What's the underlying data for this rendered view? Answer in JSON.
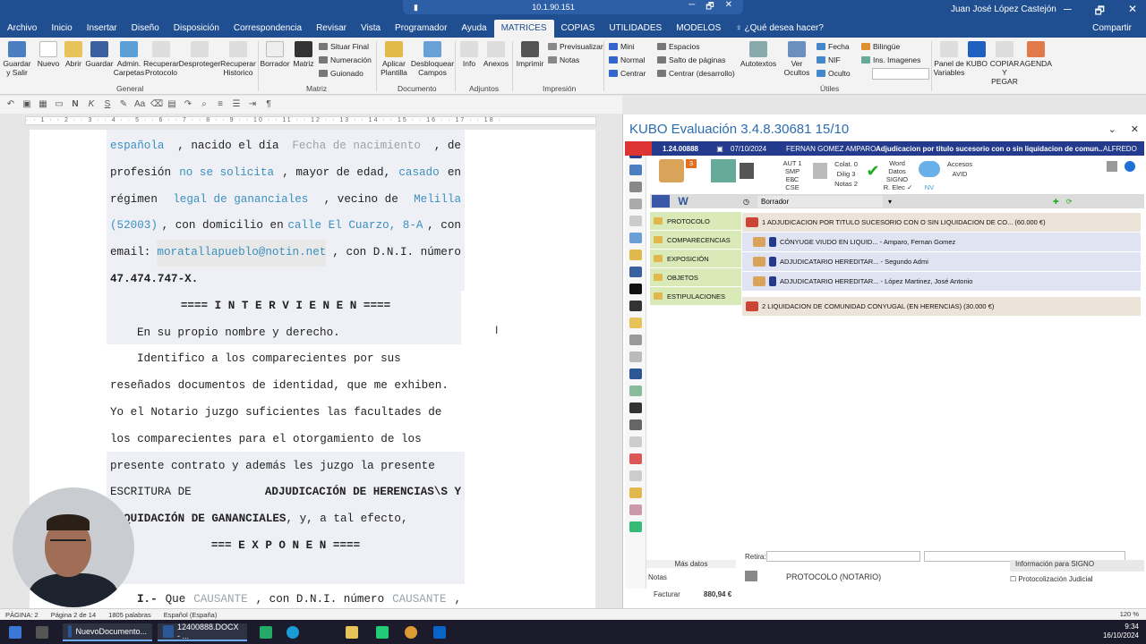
{
  "remote_bar": {
    "ip": "10.1.90.151",
    "controls": [
      "─",
      "🗗",
      "✕"
    ]
  },
  "window": {
    "user": "Juan José López Castejón",
    "controls": [
      "─",
      "🗗",
      "✕"
    ]
  },
  "ribbon_tabs": [
    "Archivo",
    "Inicio",
    "Insertar",
    "Diseño",
    "Disposición",
    "Correspondencia",
    "Revisar",
    "Vista",
    "Programador",
    "Ayuda",
    "MATRICES",
    "COPIAS",
    "UTILIDADES",
    "MODELOS",
    "♀ ¿Qué desea hacer?"
  ],
  "share": "Compartir",
  "ribbon": {
    "general": [
      "Guardar y Salir",
      "Nuevo",
      "Abrir",
      "Guardar",
      "Admin. Carpetas",
      "Recuperar Protocolo",
      "Desproteger",
      "Recuperar Historico"
    ],
    "general_label": "General",
    "matriz": [
      "Borrador",
      "Matriz"
    ],
    "matriz_small": [
      "Situar Final",
      "Numeración",
      "Guionado"
    ],
    "matriz_label": "Matriz",
    "documento": [
      "Aplicar Plantilla",
      "Desbloquear Campos"
    ],
    "documento_label": "Documento",
    "adjuntos": [
      "Info",
      "Anexos"
    ],
    "adjuntos_label": "Adjuntos",
    "impresion": [
      "Imprimir"
    ],
    "impresion_small": [
      "Previsualizar",
      "Notas"
    ],
    "impresion_label": "Impresión",
    "utiles_small": [
      "Mini",
      "Normal",
      "Centrar",
      "Espacios",
      "Salto de páginas",
      "Centrar (desarrollo)"
    ],
    "utiles": [
      "Autotextos",
      "Ver Ocultos"
    ],
    "utiles_small2": [
      "Fecha",
      "NIF",
      "Oculto"
    ],
    "utiles_label": "Útiles",
    "extra_small": [
      "Bilingüe",
      "Ins. Imagenes"
    ],
    "extra": [
      "Panel de Variables",
      "KUBO",
      "COPIAR Y PEGAR",
      "AGENDA"
    ]
  },
  "document": {
    "lines": [
      {
        "parts": [
          {
            "t": "española",
            "c": "fld"
          },
          {
            "t": ", nacido el día ",
            "c": ""
          },
          {
            "t": "Fecha de nacimiento",
            "c": "fld2"
          },
          {
            "t": ", de",
            "c": ""
          }
        ]
      },
      {
        "parts": [
          {
            "t": "profesión ",
            "c": ""
          },
          {
            "t": "no se solicita",
            "c": "fld"
          },
          {
            "t": ", mayor de edad, ",
            "c": ""
          },
          {
            "t": "casado",
            "c": "fld"
          },
          {
            "t": " en",
            "c": ""
          }
        ]
      },
      {
        "parts": [
          {
            "t": "régimen ",
            "c": ""
          },
          {
            "t": "legal de gananciales",
            "c": "fld"
          },
          {
            "t": ", vecino de ",
            "c": ""
          },
          {
            "t": "Melilla",
            "c": "fld"
          }
        ]
      },
      {
        "parts": [
          {
            "t": "(52003)",
            "c": "fld"
          },
          {
            "t": ", con domicilio en ",
            "c": ""
          },
          {
            "t": "calle El Cuarzo, 8-A",
            "c": "fld"
          },
          {
            "t": ", con",
            "c": ""
          }
        ]
      },
      {
        "parts": [
          {
            "t": "email: ",
            "c": ""
          },
          {
            "t": "moratallapueblo@notin.net",
            "c": "emailfld"
          },
          {
            "t": ", con D.N.I. número",
            "c": ""
          }
        ]
      },
      {
        "parts": [
          {
            "t": "47.474.747-X.",
            "c": "b"
          }
        ]
      }
    ],
    "heading1": "==== I N T E R V I E N E N ====",
    "para1": "En su propio nombre y derecho.",
    "para2_lines": [
      "Identifico a los comparecientes por sus",
      "reseñados documentos de identidad, que me exhiben.",
      "Yo el Notario juzgo suficientes las facultades de",
      "los comparecientes para el otorgamiento de los",
      "presente contrato y además les juzgo la presente"
    ],
    "para2_last": [
      {
        "t": "ESCRITURA DE ",
        "c": ""
      },
      {
        "t": "ADJUDICACIÓN DE HERENCIAS\\S Y",
        "c": "b"
      }
    ],
    "para2_end": [
      {
        "t": "LIQUIDACIÓN DE GANANCIALES",
        "c": "b"
      },
      {
        "t": ", y, a tal efecto,",
        "c": ""
      }
    ],
    "heading2": "=== E X P O N E N ====",
    "para3": [
      {
        "t": "I.- ",
        "c": "b"
      },
      {
        "t": "Que ",
        "c": ""
      },
      {
        "t": "CAUSANTE",
        "c": "fld2"
      },
      {
        "t": ", con D.N.I. número ",
        "c": ""
      },
      {
        "t": "CAUSANTE",
        "c": "fld2"
      },
      {
        "t": ",",
        "c": ""
      }
    ]
  },
  "kubo": {
    "title": "KUBO Evaluación 3.4.8.30681   15/10",
    "controls": [
      "⌄",
      "✕"
    ],
    "protocol_no": "1.24.00888",
    "date": "07/10/2024",
    "client": "FERNAN GOMEZ AMPARO",
    "subject": "Adjudicacion por titulo sucesorio con o sin liquidacion de comun...",
    "notary": "ALFREDO",
    "badge": "3",
    "toolbar_labels": [
      "AUT 1",
      "SMP 3",
      "ELC",
      "CSE",
      "Colat. 0",
      "Dilig 3",
      "Notas 2",
      "Word",
      "Datos",
      "SIGNO",
      "R. Elec ✓",
      "NV",
      "Accesos",
      "AVID"
    ],
    "borrador": "Borrador",
    "sections": [
      "PROTOCOLO",
      "COMPARECENCIAS",
      "EXPOSICIÓN",
      "OBJETOS",
      "ESTIPULACIONES"
    ],
    "protocol_items": [
      {
        "level": 1,
        "text": "1 ADJUDICACION POR TITULO SUCESORIO CON O SIN LIQUIDACION DE CO... (60.000 €)"
      },
      {
        "level": 2,
        "text": "CÓNYUGE VIUDO EN LIQUID... - Amparo, Fernan Gomez"
      },
      {
        "level": 2,
        "text": "ADJUDICATARIO HEREDITAR... - Segundo Admi"
      },
      {
        "level": 2,
        "text": "ADJUDICATARIO HEREDITAR... - López Martinez, José Antonio"
      },
      {
        "level": 1,
        "text": "2 LIQUIDACION DE COMUNIDAD CONYUGAL (EN HERENCIAS) (30.000 €)"
      }
    ],
    "retira_label": "Retira:",
    "mas_datos": "Más datos",
    "notas": "Notas",
    "facturar": "Facturar",
    "amount": "880,94 €",
    "folder_label": "PROTOCOLO (NOTARIO)",
    "signo_title": "Información para SIGNO",
    "protocolizacion": "Protocolización Judicial"
  },
  "status": {
    "page": "PÁGINA: 2",
    "page_of": "Página 2 de 14",
    "words": "1805 palabras",
    "lang": "Español (España)",
    "zoom": "120 %"
  },
  "taskbar": {
    "app1": "NuevoDocumento...",
    "app2": "12400888.DOCX - ...",
    "time": "9:34",
    "date": "16/10/2024"
  },
  "colors": {
    "titlebar": "#1f4e91",
    "kubo_bar": "#243a8c",
    "section_green": "#d9e9b8",
    "field_blue": "#3a8fbf"
  }
}
